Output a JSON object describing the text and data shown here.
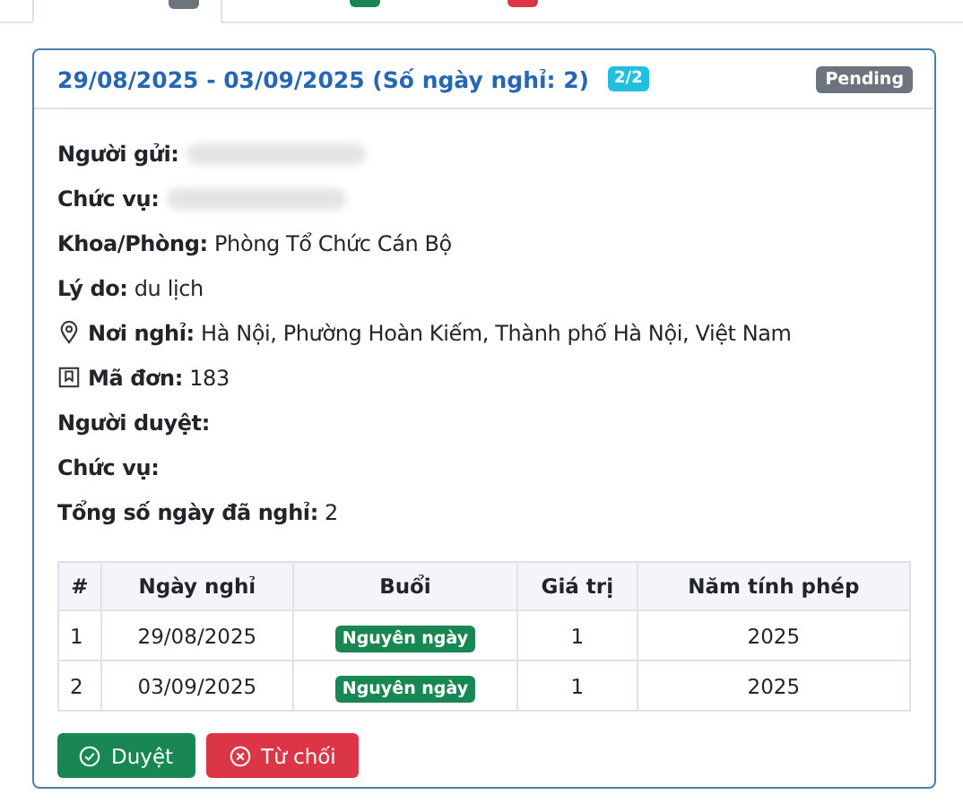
{
  "tabs": [
    {
      "selected": true,
      "color": "#6c757d"
    },
    {
      "selected": false,
      "color": "#198754"
    },
    {
      "selected": false,
      "color": "#dc3545"
    }
  ],
  "request": {
    "title": "29/08/2025 - 03/09/2025 (Số ngày nghỉ: 2)",
    "counter": "2/2",
    "status": "Pending",
    "fields": [
      {
        "label": "Người gửi:",
        "redacted": true
      },
      {
        "label": "Chức vụ:",
        "redacted": true
      },
      {
        "label": "Khoa/Phòng:",
        "value": "Phòng Tổ Chức Cán Bộ"
      },
      {
        "label": "Lý do:",
        "value": "du lịch"
      },
      {
        "label": "Nơi nghỉ:",
        "value": "Hà Nội, Phường Hoàn Kiếm, Thành phố Hà Nội, Việt Nam",
        "kind": "location"
      },
      {
        "label": "Mã đơn:",
        "value": "183",
        "kind": "code"
      },
      {
        "label": "Người duyệt:"
      },
      {
        "label": "Chức vụ:"
      },
      {
        "label": "Tổng số ngày đã nghỉ:",
        "value": "2"
      }
    ],
    "table": {
      "columns": [
        "#",
        "Ngày nghỉ",
        "Buổi",
        "Giá trị",
        "Năm tính phép"
      ],
      "rows": [
        [
          "1",
          "29/08/2025",
          "Nguyên ngày",
          "1",
          "2025"
        ],
        [
          "2",
          "03/09/2025",
          "Nguyên ngày",
          "1",
          "2025"
        ]
      ]
    },
    "buttons": [
      {
        "label": "Duyệt",
        "kind": "approve"
      },
      {
        "label": "Từ chối",
        "kind": "reject"
      }
    ]
  }
}
